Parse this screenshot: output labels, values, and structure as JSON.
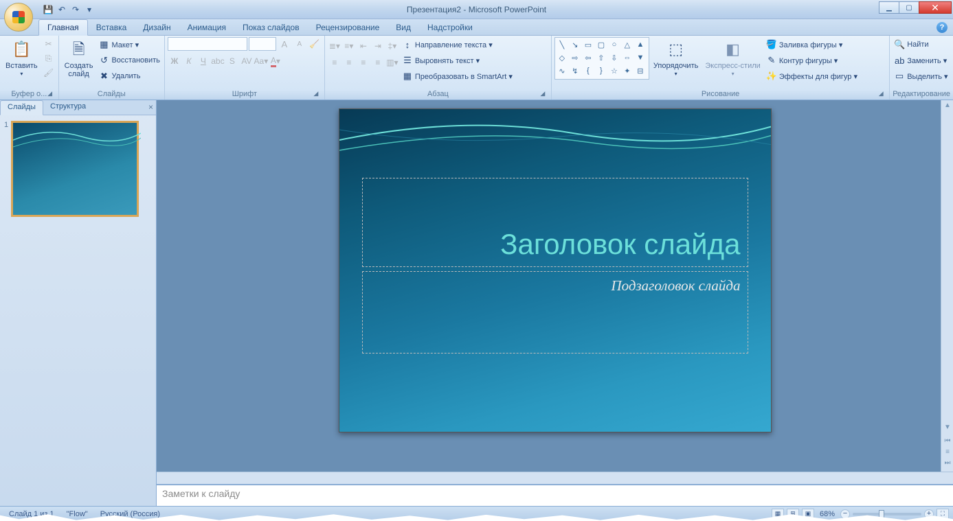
{
  "window": {
    "title": "Презентация2 - Microsoft PowerPoint"
  },
  "qat": {
    "save": "💾",
    "undo": "↶",
    "redo": "↷"
  },
  "tabs": {
    "items": [
      "Главная",
      "Вставка",
      "Дизайн",
      "Анимация",
      "Показ слайдов",
      "Рецензирование",
      "Вид",
      "Надстройки"
    ],
    "active": 0
  },
  "ribbon": {
    "clipboard": {
      "paste": "Вставить",
      "label": "Буфер о..."
    },
    "slides": {
      "new": "Создать\nслайд",
      "layout": "Макет ▾",
      "reset": "Восстановить",
      "delete": "Удалить",
      "label": "Слайды"
    },
    "font": {
      "label": "Шрифт",
      "grow": "A",
      "shrink": "A",
      "clear": "Aa"
    },
    "paragraph": {
      "label": "Абзац",
      "textdir": "Направление текста ▾",
      "align": "Выровнять текст ▾",
      "smartart": "Преобразовать в SmartArt ▾"
    },
    "drawing": {
      "label": "Рисование",
      "arrange": "Упорядочить",
      "quick": "Экспресс-стили",
      "fill": "Заливка фигуры ▾",
      "outline": "Контур фигуры ▾",
      "effects": "Эффекты для фигур ▾"
    },
    "editing": {
      "label": "Редактирование",
      "find": "Найти",
      "replace": "Заменить ▾",
      "select": "Выделить ▾"
    }
  },
  "leftPane": {
    "tabSlides": "Слайды",
    "tabOutline": "Структура",
    "slideNum": "1"
  },
  "slide": {
    "title": "Заголовок слайда",
    "subtitle": "Подзаголовок слайда"
  },
  "notes": {
    "placeholder": "Заметки к слайду"
  },
  "status": {
    "slideInfo": "Слайд 1 из 1",
    "theme": "\"Flow\"",
    "lang": "Русский (Россия)",
    "zoom": "68%"
  }
}
